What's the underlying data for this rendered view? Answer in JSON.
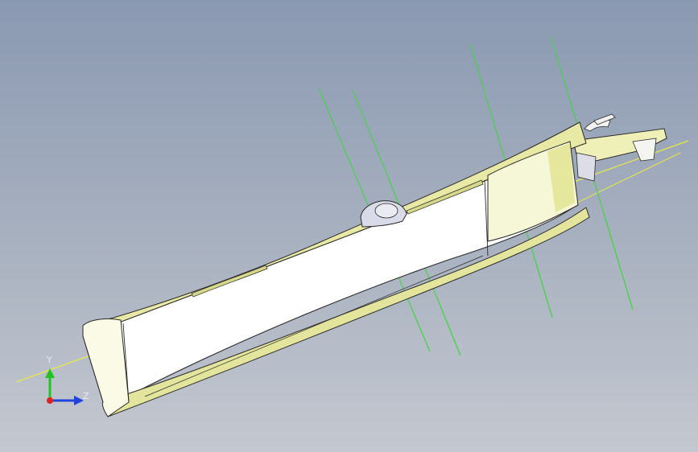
{
  "viewport": {
    "background_top": "#8a99b2",
    "background_bottom": "#c4c8d0"
  },
  "model": {
    "body_color": "#ffffff",
    "shade_color": "#e8eaa8",
    "edge_color": "#2a2a2a",
    "axis_line_color": "#3fd63f",
    "centerline_color": "#e8e84a",
    "knob_color": "#d9dbe8"
  },
  "triad": {
    "y_label": "Y",
    "z_label": "Z",
    "y_color": "#22c422",
    "z_color": "#2244dd",
    "x_color": "#dd2222"
  }
}
